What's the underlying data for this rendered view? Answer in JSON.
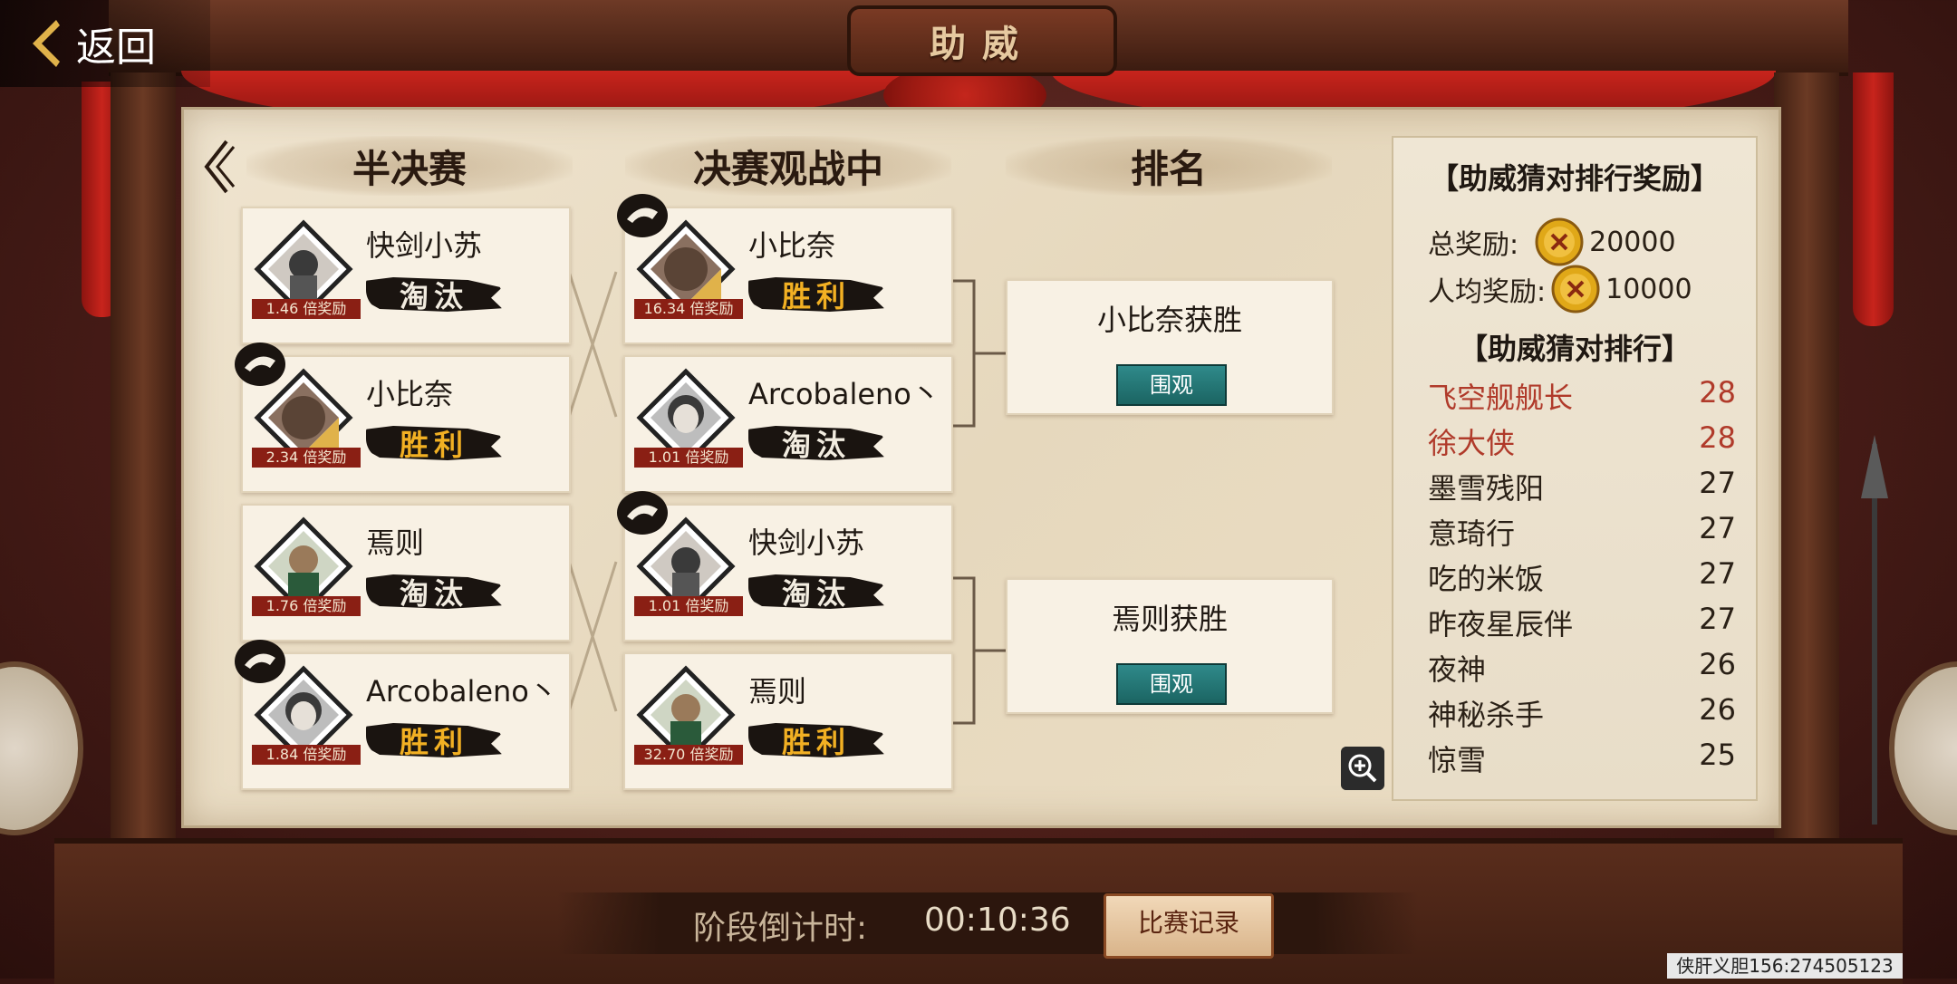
{
  "nav": {
    "back_label": "返回"
  },
  "title": "助威",
  "headers": {
    "semifinal": "半决赛",
    "final": "决赛观战中",
    "ranking": "排名"
  },
  "semifinal": [
    {
      "name": "快剑小苏",
      "odds": "1.46 倍奖励",
      "status": "淘汰",
      "result": "lose",
      "badge": false
    },
    {
      "name": "小比奈",
      "odds": "2.34 倍奖励",
      "status": "胜利",
      "result": "win",
      "badge": true
    },
    {
      "name": "焉则",
      "odds": "1.76 倍奖励",
      "status": "淘汰",
      "result": "lose",
      "badge": false
    },
    {
      "name": "Arcobaleno丶",
      "odds": "1.84 倍奖励",
      "status": "胜利",
      "result": "win",
      "badge": true
    }
  ],
  "final": [
    {
      "name": "小比奈",
      "odds": "16.34 倍奖励",
      "status": "胜利",
      "result": "win",
      "badge": true
    },
    {
      "name": "Arcobaleno丶",
      "odds": "1.01 倍奖励",
      "status": "淘汰",
      "result": "lose",
      "badge": false
    },
    {
      "name": "快剑小苏",
      "odds": "1.01 倍奖励",
      "status": "淘汰",
      "result": "lose",
      "badge": true
    },
    {
      "name": "焉则",
      "odds": "32.70 倍奖励",
      "status": "胜利",
      "result": "win",
      "badge": false
    }
  ],
  "results": [
    {
      "text": "小比奈获胜",
      "watch_label": "围观"
    },
    {
      "text": "焉则获胜",
      "watch_label": "围观"
    }
  ],
  "reward_panel": {
    "title": "【助威猜对排行奖励】",
    "total_label": "总奖励:",
    "total_value": "20000",
    "per_label": "人均奖励:",
    "per_value": "10000",
    "ranking_title": "【助威猜对排行】",
    "ranking": [
      {
        "name": "飞空舰舰长",
        "score": "28",
        "highlight": true
      },
      {
        "name": "徐大侠",
        "score": "28",
        "highlight": true
      },
      {
        "name": "墨雪残阳",
        "score": "27",
        "highlight": false
      },
      {
        "name": "意琦行",
        "score": "27",
        "highlight": false
      },
      {
        "name": "吃的米饭",
        "score": "27",
        "highlight": false
      },
      {
        "name": "昨夜星辰伴",
        "score": "27",
        "highlight": false
      },
      {
        "name": "夜神",
        "score": "26",
        "highlight": false
      },
      {
        "name": "神秘杀手",
        "score": "26",
        "highlight": false
      },
      {
        "name": "惊雪",
        "score": "25",
        "highlight": false
      }
    ]
  },
  "countdown": {
    "label": "阶段倒计时:",
    "time": "00:10:36",
    "record_label": "比赛记录"
  },
  "watermark": "侠肝义胆156:274505123",
  "colors": {
    "win": "#f2b023",
    "lose": "#f2ece0",
    "highlight": "#b03a2a",
    "watch_button": "#1b6462"
  }
}
